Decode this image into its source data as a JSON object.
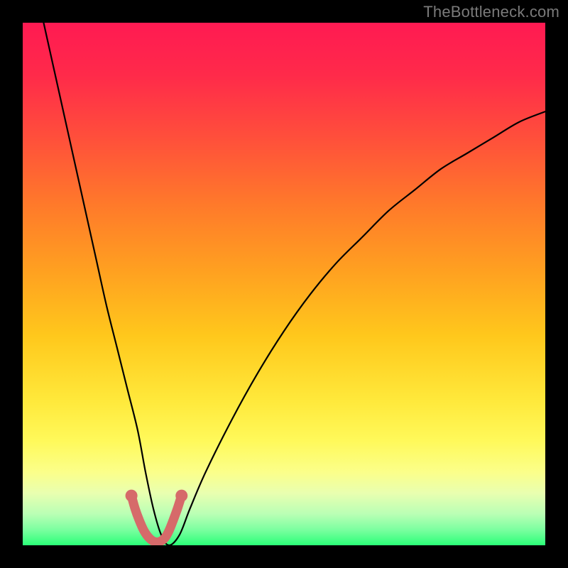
{
  "watermark": "TheBottleneck.com",
  "gradient": {
    "stops": [
      {
        "offset": 0.0,
        "color": "#ff1a52"
      },
      {
        "offset": 0.1,
        "color": "#ff2a4a"
      },
      {
        "offset": 0.22,
        "color": "#ff4f3b"
      },
      {
        "offset": 0.35,
        "color": "#ff7a2a"
      },
      {
        "offset": 0.48,
        "color": "#ffa220"
      },
      {
        "offset": 0.6,
        "color": "#ffc81c"
      },
      {
        "offset": 0.72,
        "color": "#ffe83a"
      },
      {
        "offset": 0.8,
        "color": "#fff95a"
      },
      {
        "offset": 0.86,
        "color": "#fbff8a"
      },
      {
        "offset": 0.9,
        "color": "#e9ffb0"
      },
      {
        "offset": 0.94,
        "color": "#baffb5"
      },
      {
        "offset": 0.97,
        "color": "#7cffa0"
      },
      {
        "offset": 1.0,
        "color": "#2bff78"
      }
    ]
  },
  "chart_data": {
    "type": "line",
    "title": "",
    "xlabel": "",
    "ylabel": "",
    "xlim": [
      0,
      100
    ],
    "ylim": [
      0,
      100
    ],
    "series": [
      {
        "name": "bottleneck-curve",
        "x": [
          4,
          6,
          8,
          10,
          12,
          14,
          16,
          18,
          20,
          22,
          23.5,
          25,
          26.5,
          28,
          30,
          32,
          35,
          40,
          45,
          50,
          55,
          60,
          65,
          70,
          75,
          80,
          85,
          90,
          95,
          100
        ],
        "values": [
          100,
          91,
          82,
          73,
          64,
          55,
          46,
          38,
          30,
          22,
          14,
          7,
          2,
          0,
          2,
          7,
          14,
          24,
          33,
          41,
          48,
          54,
          59,
          64,
          68,
          72,
          75,
          78,
          81,
          83
        ]
      }
    ],
    "highlight_region": {
      "name": "pink-bottom-segment",
      "color": "#d66a6a",
      "x": [
        20.8,
        21.5,
        22.3,
        23.2,
        24.2,
        25.2,
        26.2,
        27.2,
        28.0,
        28.8,
        29.6,
        30.4
      ],
      "values": [
        9.5,
        7.0,
        4.8,
        2.8,
        1.4,
        0.7,
        0.7,
        1.4,
        2.8,
        4.8,
        7.0,
        9.5
      ]
    }
  }
}
